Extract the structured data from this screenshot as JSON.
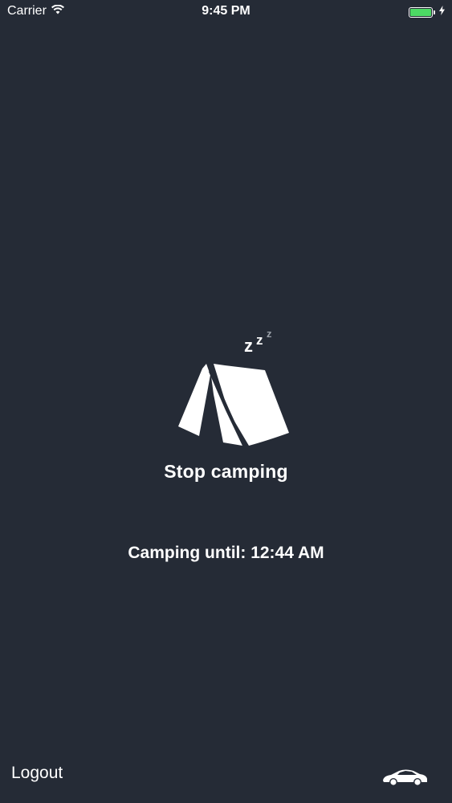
{
  "status_bar": {
    "carrier": "Carrier",
    "time": "9:45 PM",
    "battery_level": 1.0,
    "battery_color": "#4cd964"
  },
  "camp": {
    "action_label": "Stop camping",
    "until_text": "Camping until: 12:44 AM",
    "icon": "tent-icon",
    "sleep_icon": "zzz-icon"
  },
  "footer": {
    "logout_label": "Logout",
    "car_icon": "car-icon"
  },
  "colors": {
    "background": "#252b36",
    "text": "#ffffff",
    "zzz_secondary": "#9aa0a8"
  }
}
